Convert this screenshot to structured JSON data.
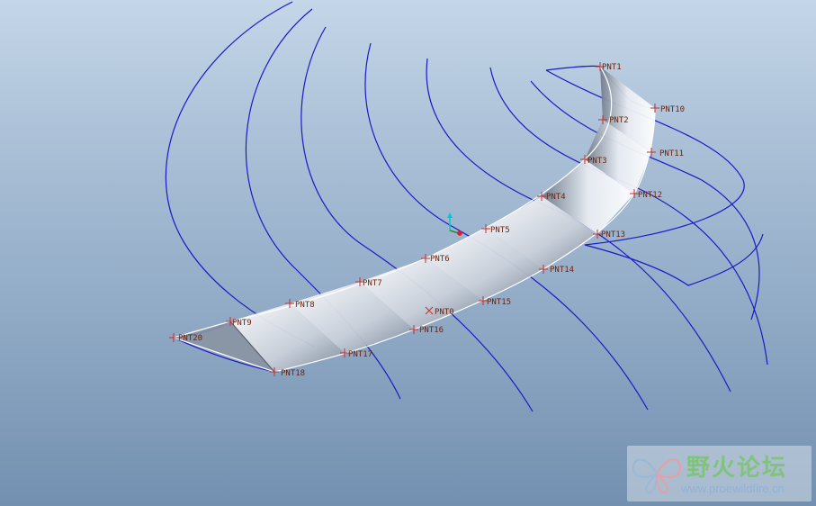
{
  "viewport": {
    "points": [
      {
        "id": "pnt1",
        "label": "PNT1"
      },
      {
        "id": "pnt2",
        "label": "PNT2"
      },
      {
        "id": "pnt3",
        "label": "PNT3"
      },
      {
        "id": "pnt4",
        "label": "PNT4"
      },
      {
        "id": "pnt5",
        "label": "PNT5"
      },
      {
        "id": "pnt6",
        "label": "PNT6"
      },
      {
        "id": "pnt7",
        "label": "PNT7"
      },
      {
        "id": "pnt8",
        "label": "PNT8"
      },
      {
        "id": "pnt9",
        "label": "PNT9"
      },
      {
        "id": "pnt10",
        "label": "PNT10"
      },
      {
        "id": "pnt11",
        "label": "PNT11"
      },
      {
        "id": "pnt12",
        "label": "PNT12"
      },
      {
        "id": "pnt13",
        "label": "PNT13"
      },
      {
        "id": "pnt14",
        "label": "PNT14"
      },
      {
        "id": "pnt15",
        "label": "PNT15"
      },
      {
        "id": "pnt16",
        "label": "PNT16"
      },
      {
        "id": "pnt17",
        "label": "PNT17"
      },
      {
        "id": "pnt18",
        "label": "PNT18"
      },
      {
        "id": "pnt20",
        "label": "PNT20"
      },
      {
        "id": "pnt0",
        "label": "PNT0"
      }
    ],
    "colors": {
      "curve": "#1a1ac8",
      "point_label": "#6b2510",
      "axis_y": "#00c8d0",
      "axis_origin": "#e02020"
    }
  },
  "watermark": {
    "title": "野火论坛",
    "url": "www.proewildfire.cn",
    "icon": "butterfly-logo-icon"
  }
}
